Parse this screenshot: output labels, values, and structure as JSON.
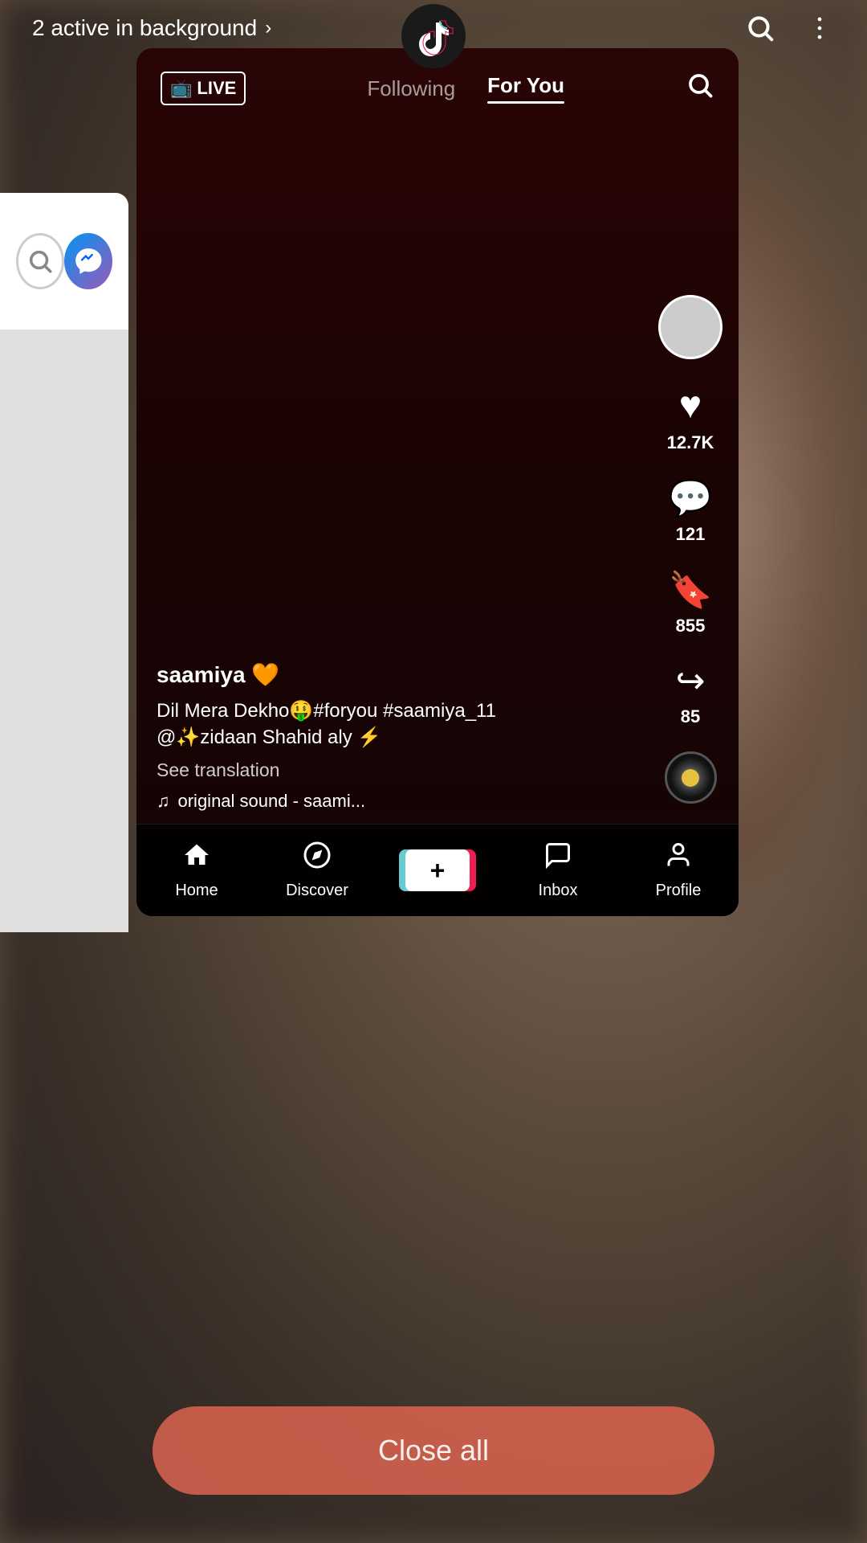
{
  "statusBar": {
    "activeBackground": "2 active in background",
    "chevron": "›"
  },
  "topBar": {
    "searchIcon": "search",
    "menuIcon": "more-vertical"
  },
  "tiktokApp": {
    "liveBadge": "LIVE",
    "navTabs": [
      {
        "id": "following",
        "label": "Following",
        "active": false
      },
      {
        "id": "foryou",
        "label": "For You",
        "active": true
      }
    ],
    "searchIcon": "search"
  },
  "videoInfo": {
    "creatorName": "saamiya 🧡",
    "caption": "Dil Mera Dekho🤑#foryou #saamiya_11\n@✨zidaan Shahid aly ⚡",
    "seeTranslation": "See translation",
    "soundInfo": "original sound - saami..."
  },
  "actions": {
    "likes": "12.7K",
    "comments": "121",
    "bookmarks": "855",
    "shares": "85"
  },
  "bottomNav": [
    {
      "id": "home",
      "label": "Home",
      "icon": "home",
      "active": true
    },
    {
      "id": "discover",
      "label": "Discover",
      "icon": "compass",
      "active": false
    },
    {
      "id": "add",
      "label": "",
      "icon": "plus",
      "active": false
    },
    {
      "id": "inbox",
      "label": "Inbox",
      "icon": "message",
      "active": false
    },
    {
      "id": "profile",
      "label": "Profile",
      "icon": "user",
      "active": false
    }
  ],
  "closeAll": "Close all"
}
